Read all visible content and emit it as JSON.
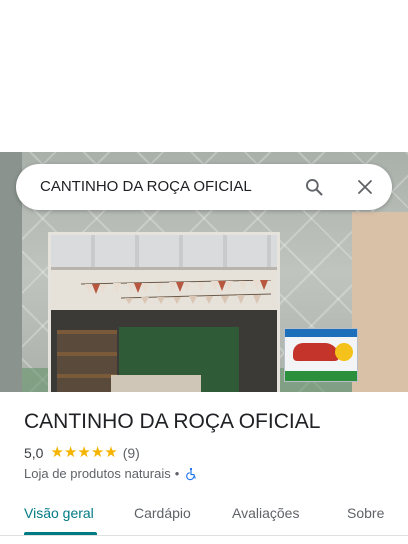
{
  "search": {
    "query": "CANTINHO DA ROÇA OFICIAL"
  },
  "place": {
    "name": "CANTINHO DA ROÇA OFICIAL",
    "rating": "5,0",
    "stars": 5,
    "review_count": "(9)",
    "category": "Loja de produtos naturais",
    "separator": "•",
    "accessibility_icon": "wheelchair-accessible-icon"
  },
  "tabs": [
    {
      "label": "Visão geral",
      "active": true
    },
    {
      "label": "Cardápio",
      "active": false
    },
    {
      "label": "Avaliações",
      "active": false
    },
    {
      "label": "Sobre",
      "active": false
    }
  ],
  "colors": {
    "accent": "#007b83",
    "star": "#f4b400",
    "text": "#202124",
    "secondary": "#5f6368"
  }
}
